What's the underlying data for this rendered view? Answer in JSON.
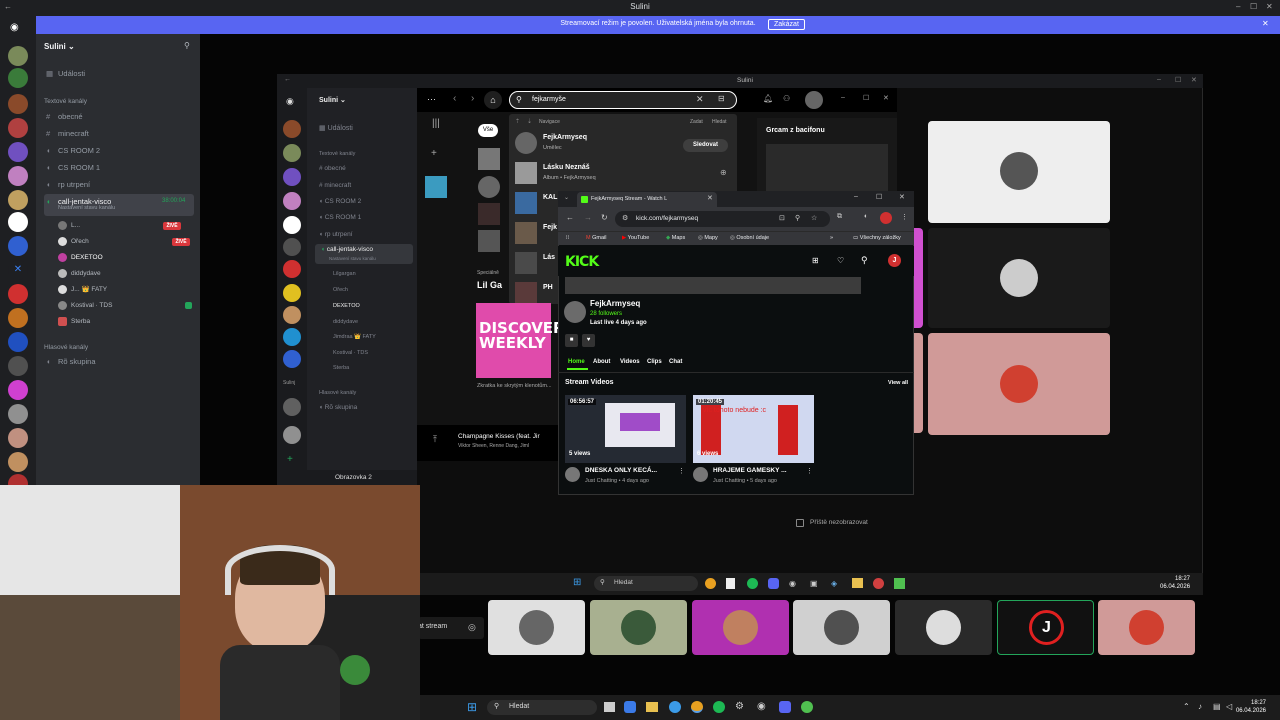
{
  "app": {
    "title": "Sulini"
  },
  "stream_banner": {
    "message": "Streamovací režim je povolen. Uživatelská jména byla ohrnuta.",
    "button": "Zakázat"
  },
  "server": {
    "name": "Sulini ⌄"
  },
  "sidebar": {
    "events": "Události",
    "text_header": "Textové kanály",
    "text_channels": [
      "obecné",
      "minecraft",
      "CS ROOM 2",
      "CS ROOM 1",
      "rp utrpení"
    ],
    "voice_channel": {
      "name": "call-jentak-visco",
      "status": "Nastavení stavu kanálu",
      "time": "38:00:04"
    },
    "voice_users": [
      {
        "name": "L...",
        "live": "ŽIVĚ"
      },
      {
        "name": "Ořech",
        "live": "ŽIVĚ"
      },
      {
        "name": "DEXETOO"
      },
      {
        "name": "diddydave"
      },
      {
        "name": "J... 👑 FATY"
      },
      {
        "name": "Kostival · TDS"
      },
      {
        "name": "Sterba"
      }
    ],
    "voice_header": "Hlasové kanály",
    "voice_group": "Rõ skupina"
  },
  "nested": {
    "title": "Sulini",
    "server": "Sulini ⌄",
    "events": "Události",
    "text_header": "Textové kanály",
    "channels": [
      "obecné",
      "minecraft",
      "CS ROOM 2",
      "CS ROOM 1",
      "rp utrpení"
    ],
    "voice_channel": "call-jentak-visco",
    "status": "Nastavení stavu kanálu",
    "users": [
      "Lilgargan",
      "Ořech",
      "DEXETOO",
      "diddydave",
      "Jimdraa 👑 FATY",
      "Kostival · TDS",
      "Sterba"
    ],
    "voice_header": "Hlasové kanály",
    "voice_group": "Rõ skupina",
    "screen_label": "Obrazovka 2",
    "rail_label": "Sulinj"
  },
  "spotify": {
    "search_query": "fejkarmyše",
    "chip_all": "Vše",
    "recent": "Navigace",
    "clear": "Zadat",
    "search_label": "Hledat",
    "results": [
      {
        "name": "FejkArmyseq",
        "sub": "Umělec"
      },
      {
        "name": "Lásku Neznáš",
        "sub": "Album • FejkArmyseq"
      },
      {
        "name": "KAL",
        "sub": ""
      },
      {
        "name": "Fejk",
        "sub": ""
      },
      {
        "name": "Lás",
        "sub": ""
      },
      {
        "name": "PH",
        "sub": ""
      }
    ],
    "follow": "Sledovat",
    "special": "Speciálně",
    "lil_ga": "Lil Ga",
    "right_title": "Grcam z bacifonu",
    "discover_weekly": "DISCOVER WEEKLY",
    "dw_caption": "Zkratka ke skrytým klenotům...",
    "now_playing": "Champagne Kisses (feat. Jir",
    "now_artist": "Viktor Sheen, Renne Dang, Jiml"
  },
  "chrome": {
    "tab_title": "FejkArmyseq Stream - Watch L",
    "url": "kick.com/fejkarmyseq",
    "bookmarks": [
      "Gmail",
      "YouTube",
      "Maps",
      "Mapy",
      "Osobní údaje"
    ],
    "all_bookmarks": "Všechny záložky",
    "kick": {
      "logo": "KICK",
      "channel": "FejkArmyseq",
      "followers": "28 followers",
      "last_live": "Last live 4 days ago",
      "avatar_initial": "J",
      "tabs": [
        "Home",
        "About",
        "Videos",
        "Clips",
        "Chat"
      ],
      "section": "Stream Videos",
      "view_all": "View all",
      "videos": [
        {
          "duration": "06:56:57",
          "views": "5 views",
          "title": "DNESKA ONLY KECÁ...",
          "sub": "Just Chatting • 4 days ago"
        },
        {
          "duration": "01:20:45",
          "views": "6 views",
          "title": "HRAJEME GAMESKY ...",
          "sub": "Just Chatting • 5 days ago"
        }
      ],
      "thumb_text": "víc tohoto nebude :c"
    }
  },
  "dont_show": "Příště nezobrazovat",
  "inner_taskbar": {
    "search": "Hledat",
    "time": "18:27",
    "date": "06.04.2026"
  },
  "stream_btn": "at stream",
  "taskbar": {
    "search": "Hledat",
    "time": "18:27",
    "date": "06.04.2026"
  },
  "colors": {
    "discord_blurple": "#5865f2",
    "kick_green": "#53fc18",
    "live_red": "#da373c"
  }
}
